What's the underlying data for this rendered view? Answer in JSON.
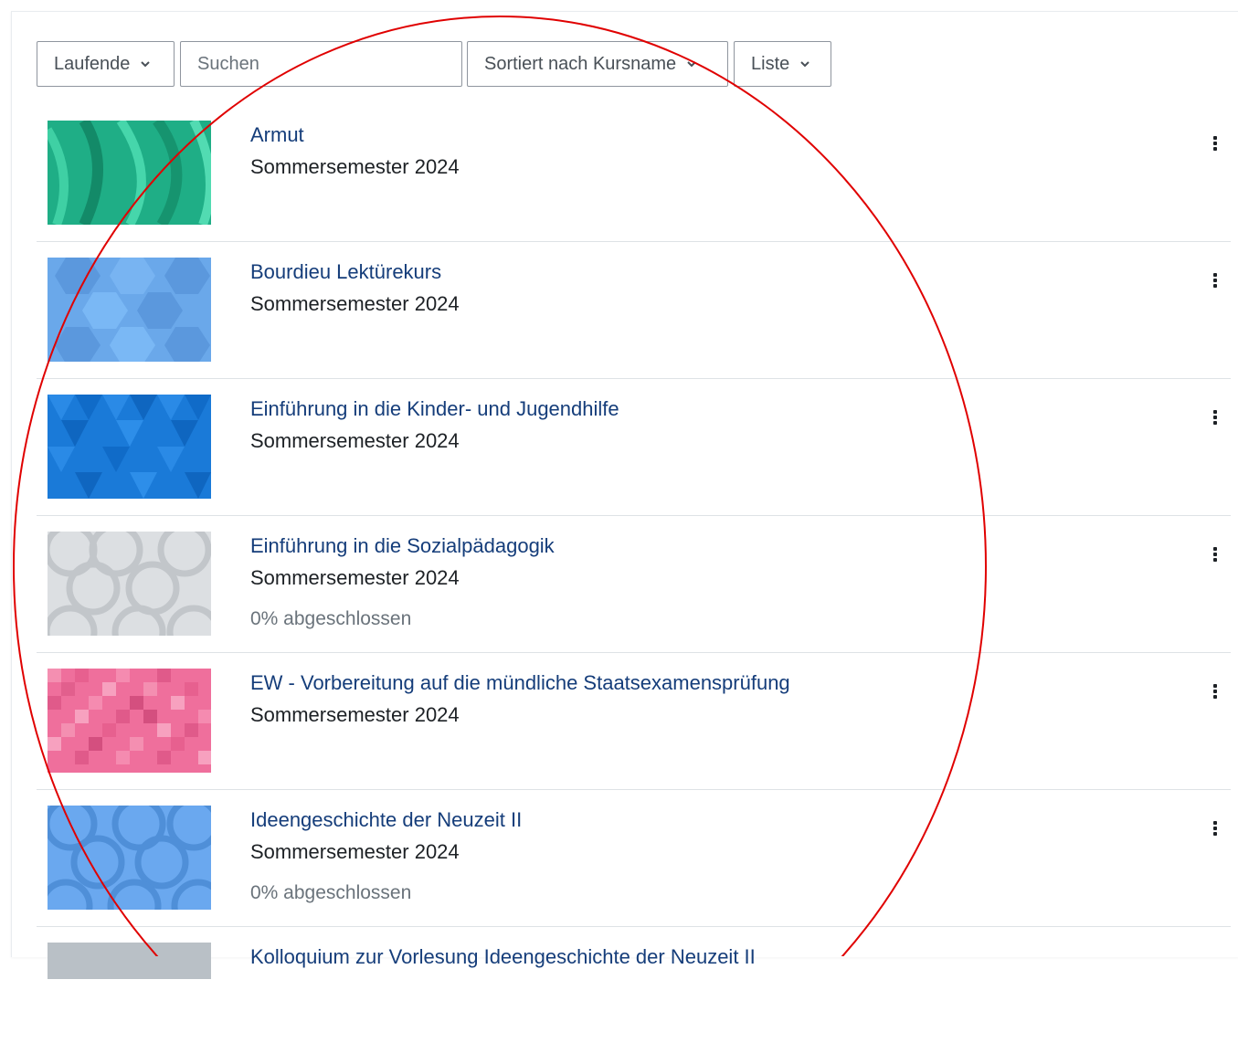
{
  "toolbar": {
    "filter_label": "Laufende",
    "search_placeholder": "Suchen",
    "sort_label": "Sortiert nach Kursname",
    "view_label": "Liste"
  },
  "courses": [
    {
      "name": "Armut",
      "term": "Sommersemester 2024",
      "progress": "",
      "pattern": "waves-green"
    },
    {
      "name": "Bourdieu Lektürekurs",
      "term": "Sommersemester 2024",
      "progress": "",
      "pattern": "hexagons-lightblue"
    },
    {
      "name": "Einführung in die Kinder- und Jugendhilfe",
      "term": "Sommersemester 2024",
      "progress": "",
      "pattern": "triangles-blue"
    },
    {
      "name": "Einführung in die Sozialpädagogik",
      "term": "Sommersemester 2024",
      "progress": "0% abgeschlossen",
      "pattern": "circles-grey"
    },
    {
      "name": "EW - Vorbereitung auf die mündliche Staatsexamensprüfung",
      "term": "Sommersemester 2024",
      "progress": "",
      "pattern": "squares-pink"
    },
    {
      "name": "Ideengeschichte der Neuzeit II",
      "term": "Sommersemester 2024",
      "progress": "0% abgeschlossen",
      "pattern": "circles-blue"
    },
    {
      "name": "Kolloquium zur Vorlesung Ideengeschichte der Neuzeit II",
      "term": "",
      "progress": "",
      "pattern": "grey"
    }
  ],
  "colors": {
    "link": "#153d7a",
    "annotation": "#e00000",
    "divider": "#dee2e6"
  }
}
